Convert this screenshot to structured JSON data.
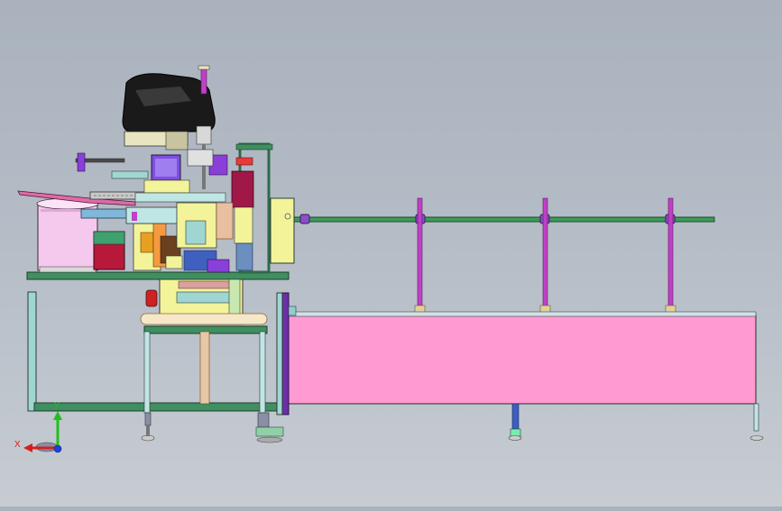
{
  "triad": {
    "x_label": "X",
    "y_label": "Y"
  },
  "colors": {
    "frame_outline": "#2f3b33",
    "table_green": "#3f8f60",
    "leg_light": "#9fd6d2",
    "leg_purple": "#6b2fa8",
    "conveyor_pink": "#ff9bd2",
    "rail_green": "#3e9a5a",
    "rod_magenta": "#c040c8",
    "head_black": "#1a1a1a",
    "module_yellow": "#f3f39a",
    "bowl_pink": "#f5c8ee",
    "axis_x": "#d42020",
    "axis_y": "#20c020",
    "axis_z": "#2040d8"
  }
}
